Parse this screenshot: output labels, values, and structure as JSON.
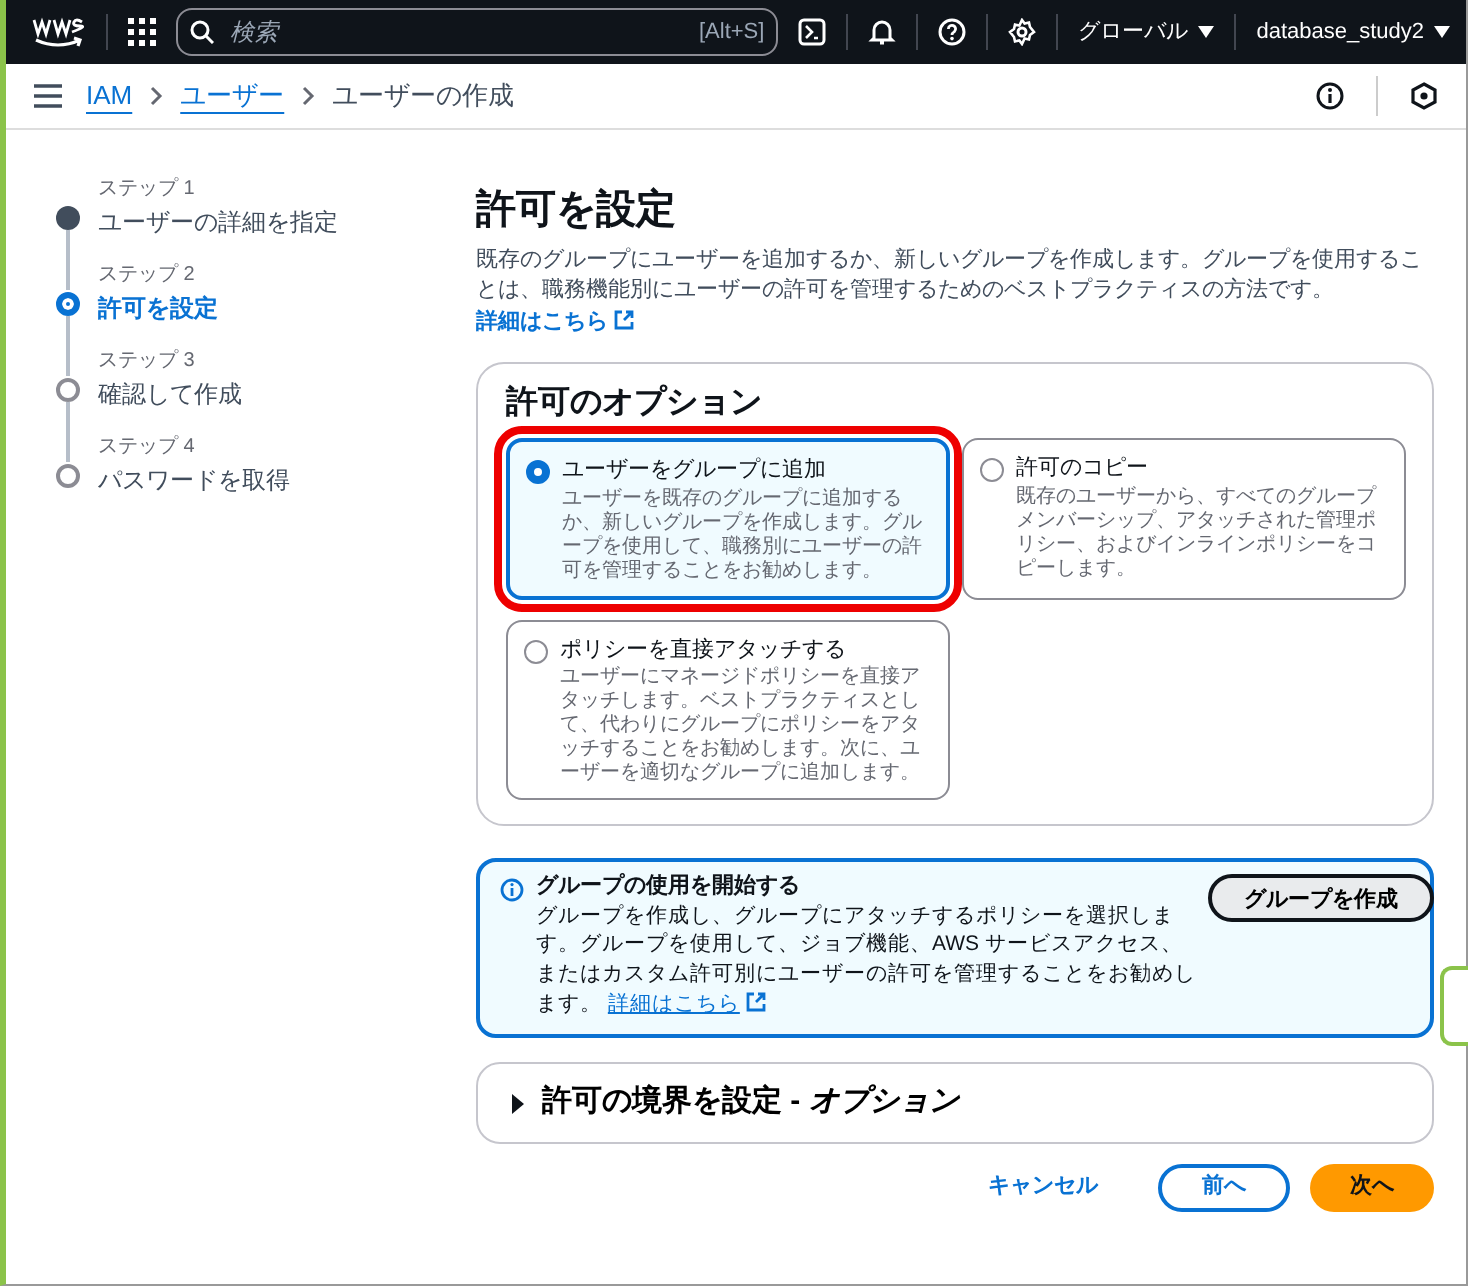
{
  "topbar": {
    "search_placeholder": "検索",
    "shortcut": "[Alt+S]",
    "region": "グローバル",
    "account": "database_study2"
  },
  "breadcrumb": [
    {
      "label": "IAM",
      "kind": "link"
    },
    {
      "label": "ユーザー",
      "kind": "link"
    },
    {
      "label": "ユーザーの作成",
      "kind": "current"
    }
  ],
  "steps": [
    {
      "step": "ステップ 1",
      "label": "ユーザーの詳細を指定",
      "kind": "done"
    },
    {
      "step": "ステップ 2",
      "label": "許可を設定",
      "kind": "current"
    },
    {
      "step": "ステップ 3",
      "label": "確認して作成",
      "kind": "pending"
    },
    {
      "step": "ステップ 4",
      "label": "パスワードを取得",
      "kind": "pending"
    }
  ],
  "page": {
    "title": "許可を設定",
    "description": "既存のグループにユーザーを追加するか、新しいグループを作成します。グループを使用することは、職務機能別にユーザーの許可を管理するためのベストプラクティスの方法です。",
    "link": "詳細はこちら"
  },
  "permission_options": {
    "heading": "許可のオプション",
    "items": [
      {
        "label": "ユーザーをグループに追加",
        "description": "ユーザーを既存のグループに追加するか、新しいグループを作成します。グループを使用して、職務別にユーザーの許可を管理することをお勧めします。",
        "selected": true,
        "highlighted": true
      },
      {
        "label": "許可のコピー",
        "description": "既存のユーザーから、すべてのグループメンバーシップ、アタッチされた管理ポリシー、およびインラインポリシーをコピーします。",
        "selected": false,
        "highlighted": false
      },
      {
        "label": "ポリシーを直接アタッチする",
        "description": "ユーザーにマネージドポリシーを直接アタッチします。ベストプラクティスとして、代わりにグループにポリシーをアタッチすることをお勧めします。次に、ユーザーを適切なグループに追加します。",
        "selected": false,
        "highlighted": false
      }
    ]
  },
  "info_panel": {
    "title": "グループの使用を開始する",
    "text": "グループを作成し、グループにアタッチするポリシーを選択します。グループを使用して、ジョブ機能、AWS サービスアクセス、またはカスタム許可別にユーザーの許可を管理することをお勧めします。",
    "link": "詳細はこちら",
    "button": "グループを作成"
  },
  "boundary_section": {
    "label": "許可の境界を設定 - *オプション*",
    "expanded": false
  },
  "footer_buttons": [
    {
      "label": "キャンセル",
      "kind": "link"
    },
    {
      "label": "前へ",
      "kind": "secondary"
    },
    {
      "label": "次へ",
      "kind": "primary"
    }
  ]
}
